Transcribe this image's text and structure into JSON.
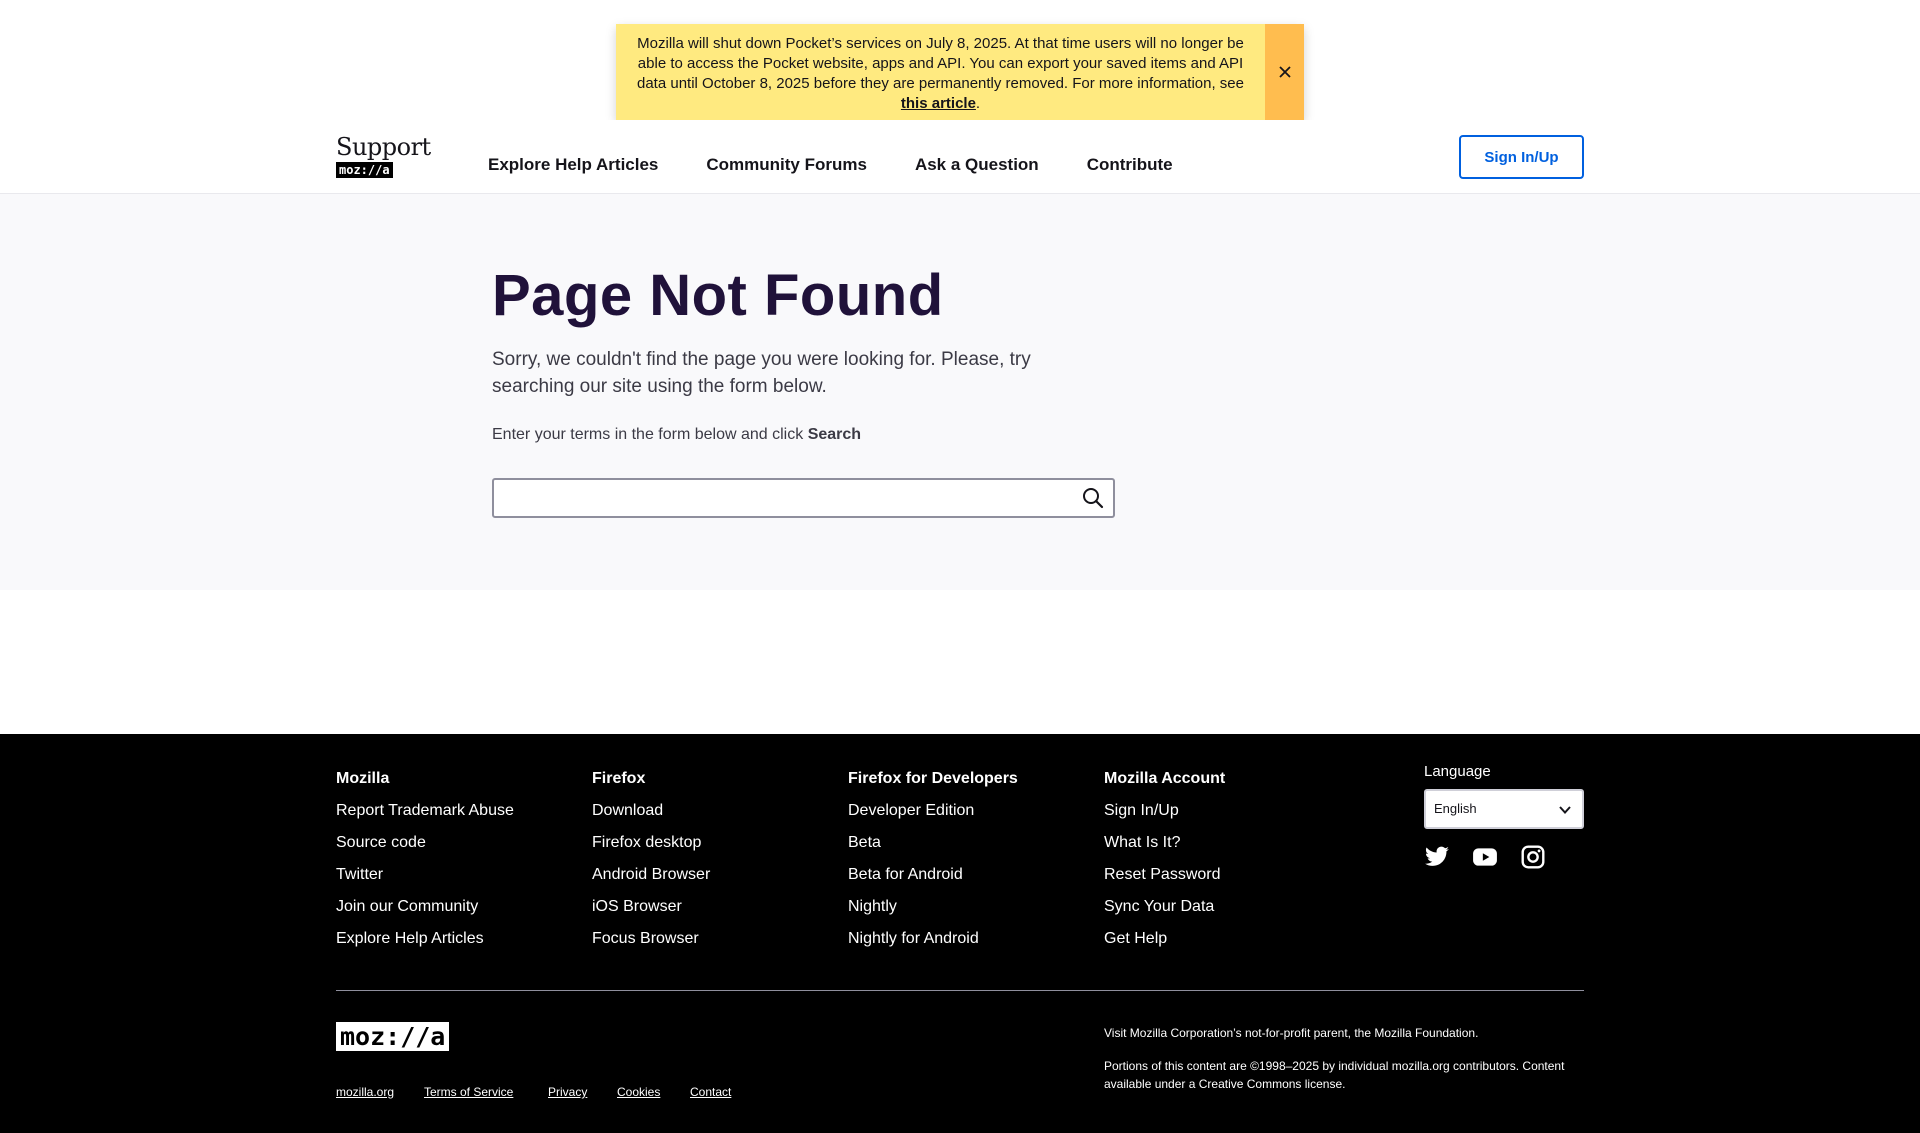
{
  "banner": {
    "text_before_link": "Mozilla will shut down Pocket’s services on July 8, 2025. At that time users will no longer be able to access the Pocket website, apps and API. You can export your saved items and API data until October 8, 2025 before they are permanently removed. For more information, see ",
    "link_text": "this article",
    "text_after_link": ".",
    "close_icon": "close-icon",
    "background_color": "#ffea80",
    "close_background_color": "#ffbd4f"
  },
  "header": {
    "logo_support": "Support",
    "logo_mozilla": "moz://a",
    "nav": [
      {
        "label": "Explore Help Articles"
      },
      {
        "label": "Community Forums"
      },
      {
        "label": "Ask a Question"
      },
      {
        "label": "Contribute"
      }
    ],
    "signin_label": "Sign In/Up",
    "accent_color": "#0060df"
  },
  "main": {
    "title": "Page Not Found",
    "sorry_text": "Sorry, we couldn't find the page you were looking for. Please, try searching our site using the form below.",
    "instruction_text": "Enter your terms in the form below and click ",
    "instruction_bold": "Search",
    "search_value": "",
    "search_icon": "search-icon",
    "title_color": "#20123a"
  },
  "footer": {
    "columns": [
      {
        "title": "Mozilla",
        "links": [
          "Report Trademark Abuse",
          "Source code",
          "Twitter",
          "Join our Community",
          "Explore Help Articles"
        ]
      },
      {
        "title": "Firefox",
        "links": [
          "Download",
          "Firefox desktop",
          "Android Browser",
          "iOS Browser",
          "Focus Browser"
        ]
      },
      {
        "title": "Firefox for Developers",
        "links": [
          "Developer Edition",
          "Beta",
          "Beta for Android",
          "Nightly",
          "Nightly for Android"
        ]
      },
      {
        "title": "Mozilla Account",
        "links": [
          "Sign In/Up",
          "What Is It?",
          "Reset Password",
          "Sync Your Data",
          "Get Help"
        ]
      }
    ],
    "language_label": "Language",
    "language_value": "English",
    "social_icons": [
      "twitter-icon",
      "youtube-icon",
      "instagram-icon"
    ],
    "logo": "moz://a",
    "legal_links": [
      "mozilla.org",
      "Terms of Service",
      "Privacy",
      "Cookies",
      "Contact"
    ],
    "note_1": "Visit Mozilla Corporation’s not-for-profit parent, the Mozilla Foundation.",
    "note_2": "Portions of this content are ©1998–2025 by individual mozilla.org contributors. Content available under a Creative Commons license."
  }
}
